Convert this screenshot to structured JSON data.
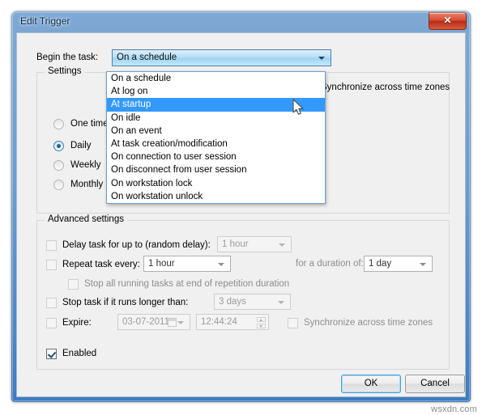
{
  "window": {
    "title": "Edit Trigger",
    "close_glyph": "✕"
  },
  "begin_task": {
    "label": "Begin the task:",
    "selected_value": "On a schedule",
    "options": [
      "On a schedule",
      "At log on",
      "At startup",
      "On idle",
      "On an event",
      "At task creation/modification",
      "On connection to user session",
      "On disconnect from user session",
      "On workstation lock",
      "On workstation unlock"
    ],
    "highlighted_option": "At startup",
    "highlighted_index": 2
  },
  "settings": {
    "legend": "Settings",
    "radios": [
      {
        "label": "One time",
        "checked": false
      },
      {
        "label": "Daily",
        "checked": true
      },
      {
        "label": "Weekly",
        "checked": false
      },
      {
        "label": "Monthly",
        "checked": false
      }
    ],
    "sync_label": "Synchronize across time zones",
    "sync_checked": false
  },
  "advanced": {
    "legend": "Advanced settings",
    "delay": {
      "label": "Delay task for up to (random delay):",
      "checked": false,
      "value": "1 hour"
    },
    "repeat": {
      "label": "Repeat task every:",
      "checked": false,
      "value": "1 hour",
      "duration_label": "for a duration of:",
      "duration_value": "1 day"
    },
    "stop_running": {
      "label": "Stop all running tasks at end of repetition duration",
      "checked": false
    },
    "stop_task": {
      "label": "Stop task if it runs longer than:",
      "checked": false,
      "value": "3 days"
    },
    "expire": {
      "label": "Expire:",
      "checked": false,
      "date": "03-07-2011",
      "time": "12:44:24",
      "sync_label": "Synchronize across time zones",
      "sync_checked": false
    },
    "enabled": {
      "label": "Enabled",
      "checked": true
    }
  },
  "buttons": {
    "ok": "OK",
    "cancel": "Cancel"
  },
  "watermark": "wsxdn.com",
  "colors": {
    "accent": "#3399ff",
    "titlebar": "#6c9bcd",
    "close_button": "#d5482f",
    "dialog_face": "#f0f0f0"
  }
}
